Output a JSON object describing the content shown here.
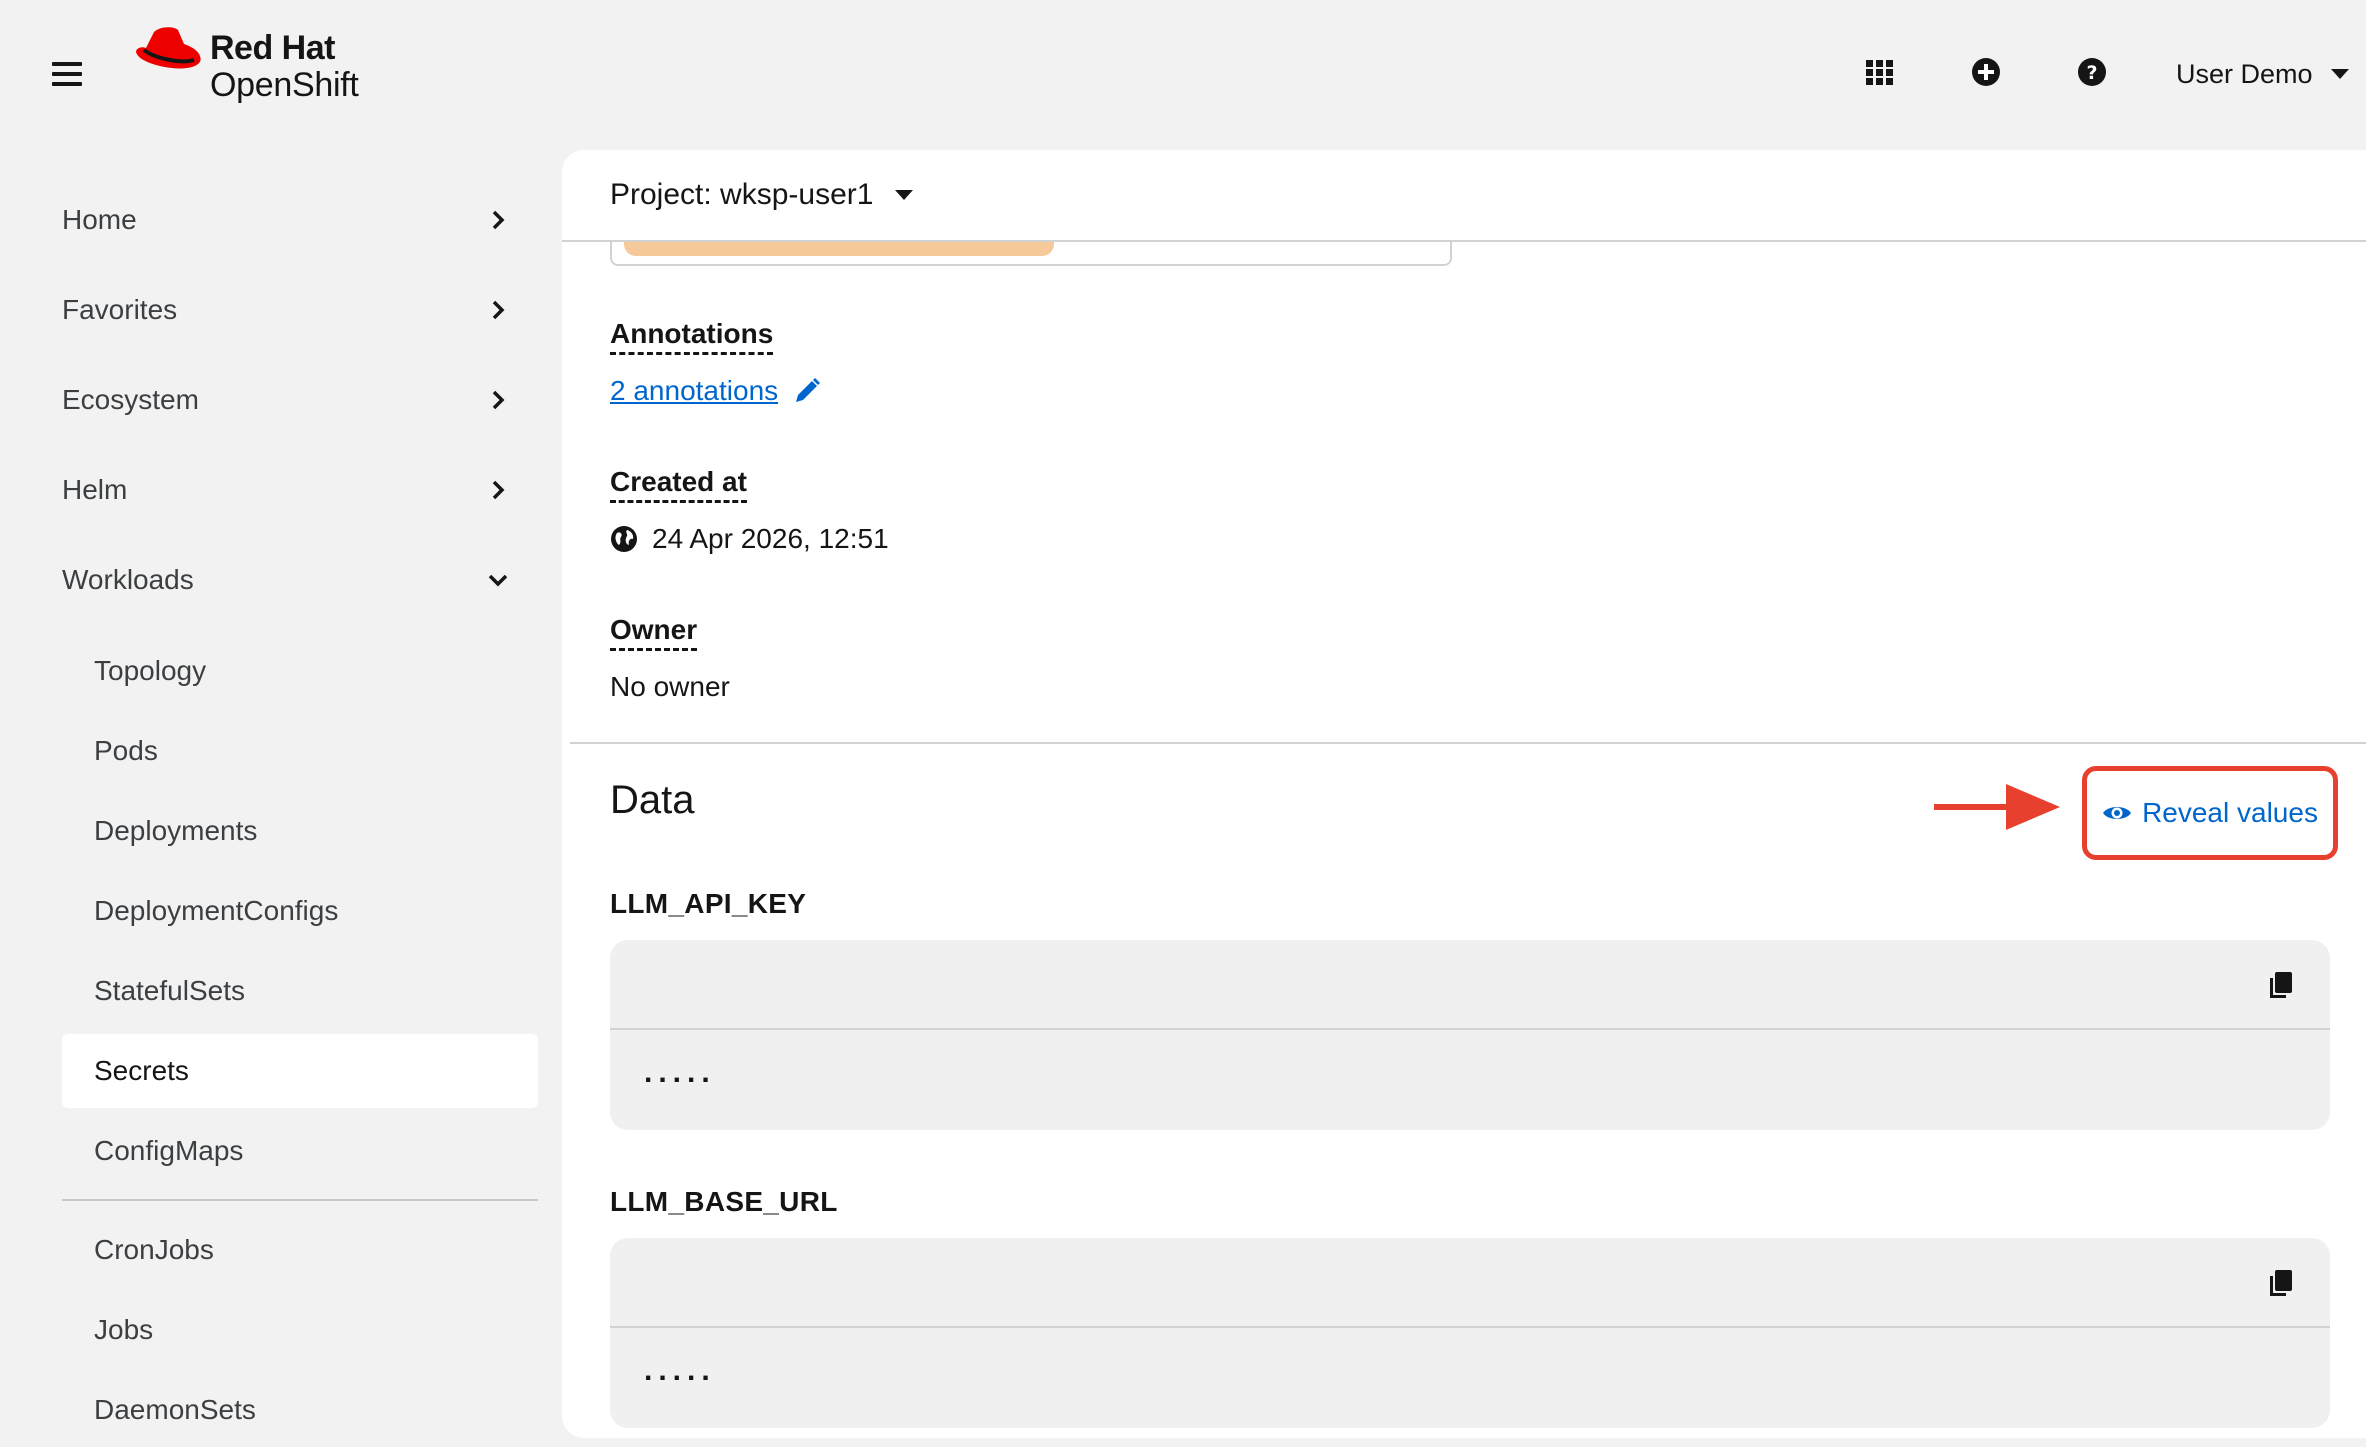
{
  "masthead": {
    "brand_line1": "Red Hat",
    "brand_line2": "OpenShift",
    "icons": [
      "hamburger-menu-icon",
      "app-launcher-icon",
      "quick-create-icon",
      "help-icon",
      "caret-down-icon"
    ],
    "user_name": "User Demo"
  },
  "sidebar": {
    "sections": [
      {
        "label": "Home",
        "expanded": false
      },
      {
        "label": "Favorites",
        "expanded": false
      },
      {
        "label": "Ecosystem",
        "expanded": false
      },
      {
        "label": "Helm",
        "expanded": false
      },
      {
        "label": "Workloads",
        "expanded": true
      }
    ],
    "workloads_items": [
      "Topology",
      "Pods",
      "Deployments",
      "DeploymentConfigs",
      "StatefulSets",
      "Secrets",
      "ConfigMaps",
      "CronJobs",
      "Jobs",
      "DaemonSets"
    ],
    "active_item": "Secrets"
  },
  "project": {
    "label": "Project: wksp-user1"
  },
  "details": {
    "annotations_label": "Annotations",
    "annotations_value": "2 annotations",
    "created_label": "Created at",
    "created_value": "24 Apr 2026, 12:51",
    "owner_label": "Owner",
    "owner_value": "No owner"
  },
  "data_section": {
    "title": "Data",
    "reveal_label": "Reveal values",
    "entries": [
      {
        "key": "LLM_API_KEY",
        "masked": "....."
      },
      {
        "key": "LLM_BASE_URL",
        "masked": "....."
      }
    ]
  },
  "colors": {
    "brand_red": "#ee0000",
    "link_blue": "#0066cc",
    "annotation_highlight": "#e8402e",
    "label_pill": "#f5c99a"
  }
}
